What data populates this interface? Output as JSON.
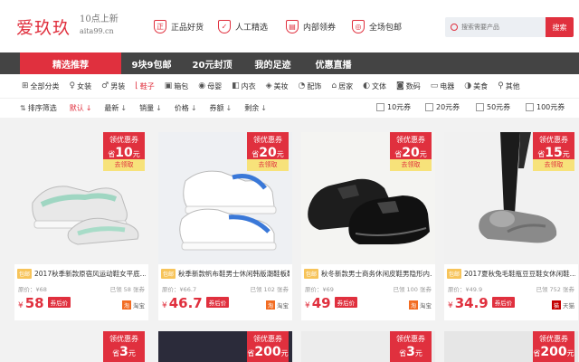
{
  "header": {
    "logo_text": "爱玖玖",
    "slogan_line1": "10点上新",
    "slogan_line2": "aita99.cn",
    "features": [
      {
        "icon": "正",
        "label": "正品好货"
      },
      {
        "icon": "✓",
        "label": "人工精选"
      },
      {
        "icon": "▤",
        "label": "内部领券"
      },
      {
        "icon": "◎",
        "label": "全场包邮"
      }
    ],
    "search_placeholder": "搜索需要产品",
    "search_button": "搜索"
  },
  "nav": {
    "items": [
      "精选推荐",
      "9块9包邮",
      "20元封顶",
      "我的足迹",
      "优惠直播"
    ]
  },
  "categories": [
    {
      "icon": "⊞",
      "label": "全部分类"
    },
    {
      "icon": "♀",
      "label": "女装"
    },
    {
      "icon": "♂",
      "label": "男装"
    },
    {
      "icon": "⌊",
      "label": "鞋子"
    },
    {
      "icon": "▣",
      "label": "箱包"
    },
    {
      "icon": "◉",
      "label": "母婴"
    },
    {
      "icon": "◧",
      "label": "内衣"
    },
    {
      "icon": "◈",
      "label": "美妆"
    },
    {
      "icon": "◔",
      "label": "配饰"
    },
    {
      "icon": "⌂",
      "label": "居家"
    },
    {
      "icon": "◐",
      "label": "文体"
    },
    {
      "icon": "◙",
      "label": "数码"
    },
    {
      "icon": "▭",
      "label": "电器"
    },
    {
      "icon": "◑",
      "label": "美食"
    },
    {
      "icon": "⚲",
      "label": "其他"
    }
  ],
  "active_category": "鞋子",
  "sorts": [
    {
      "label": "排序筛选",
      "arrow": "⇅"
    },
    {
      "label": "默认",
      "arrow": "↓"
    },
    {
      "label": "最新",
      "arrow": "↓"
    },
    {
      "label": "销量",
      "arrow": "↓"
    },
    {
      "label": "价格",
      "arrow": "↓"
    },
    {
      "label": "券额",
      "arrow": "↓"
    },
    {
      "label": "剩余",
      "arrow": "↓"
    }
  ],
  "coupon_filters": [
    "10元券",
    "20元券",
    "50元券",
    "100元券"
  ],
  "coupon_tag": {
    "line1": "领优惠券",
    "prefix": "省",
    "suffix": "元",
    "cta": "去领取"
  },
  "products": [
    {
      "coupon": "10",
      "badge": "包邮",
      "title": "2017秋季新款原宿风运动鞋女平底…",
      "orig_label": "原价：",
      "orig": "¥68",
      "sold": "已领 58 张券",
      "price": "58",
      "coupon_btn": "券后价",
      "shop": "淘宝",
      "shop_type": "taobao"
    },
    {
      "coupon": "20",
      "badge": "包邮",
      "title": "秋季新款帆布鞋男士休闲韩版潮鞋板鞋…",
      "orig_label": "原价：",
      "orig": "¥66.7",
      "sold": "已领 102 张券",
      "price": "46.7",
      "coupon_btn": "券后价",
      "shop": "淘宝",
      "shop_type": "taobao"
    },
    {
      "coupon": "20",
      "badge": "包邮",
      "title": "秋冬新款男士商务休闲皮鞋男隐形内…",
      "orig_label": "原价：",
      "orig": "¥69",
      "sold": "已领 100 张券",
      "price": "49",
      "coupon_btn": "券后价",
      "shop": "淘宝",
      "shop_type": "taobao"
    },
    {
      "coupon": "15",
      "badge": "包邮",
      "title": "2017夏秋兔毛鞋瓶豆豆鞋女休闲鞋…",
      "orig_label": "原价：",
      "orig": "¥49.9",
      "sold": "已领 752 张券",
      "price": "34.9",
      "coupon_btn": "券后价",
      "shop": "天猫",
      "shop_type": "tmall"
    }
  ],
  "products_row2": [
    {
      "coupon": "3"
    },
    {
      "coupon": "200"
    },
    {
      "coupon": "3"
    },
    {
      "coupon": "200"
    }
  ],
  "colors": {
    "accent": "#e0303e",
    "nav_bg": "#444444"
  }
}
